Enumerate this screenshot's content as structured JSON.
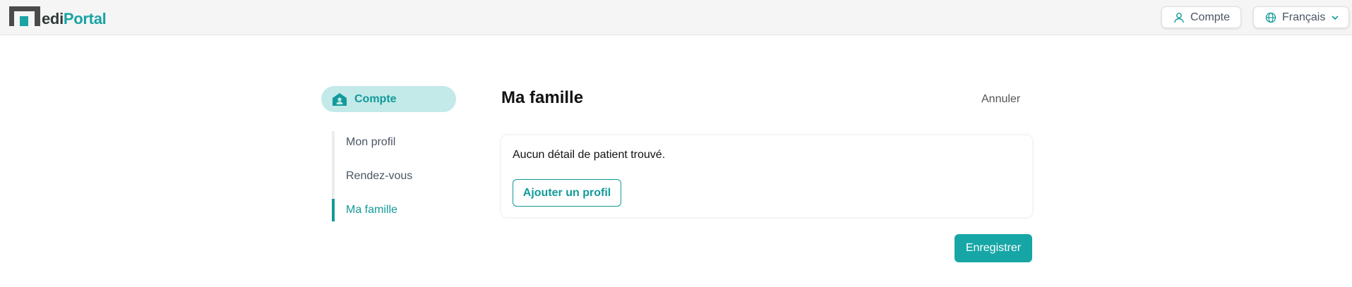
{
  "header": {
    "logo": {
      "part1": "edi",
      "part2": "Portal"
    },
    "account_label": "Compte",
    "language_label": "Français"
  },
  "sidebar": {
    "section_label": "Compte",
    "items": [
      {
        "label": "Mon profil",
        "active": false
      },
      {
        "label": "Rendez-vous",
        "active": false
      },
      {
        "label": "Ma famille",
        "active": true
      }
    ]
  },
  "main": {
    "title": "Ma famille",
    "cancel_label": "Annuler",
    "empty_message": "Aucun détail de patient trouvé.",
    "add_profile_label": "Ajouter un profil",
    "save_label": "Enregistrer"
  },
  "colors": {
    "accent": "#139a9a",
    "accent_light": "#c3e9e9",
    "header_bg": "#f5f5f5"
  },
  "icons": [
    "account-icon",
    "globe-icon",
    "chevron-down-icon",
    "home-account-icon"
  ]
}
